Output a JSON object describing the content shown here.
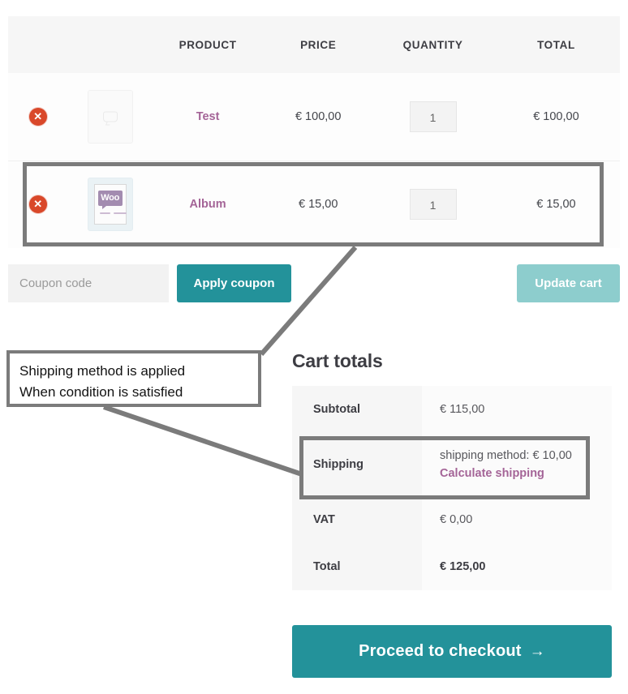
{
  "cart_table": {
    "headers": [
      "",
      "",
      "PRODUCT",
      "PRICE",
      "QUANTITY",
      "TOTAL"
    ],
    "remove_icon": "remove-x-icon",
    "rows": [
      {
        "remove_label": "✕",
        "thumbnail": "product-placeholder-image",
        "product": "Test",
        "price": "€ 100,00",
        "quantity": "1",
        "total": "€ 100,00"
      },
      {
        "remove_label": "✕",
        "thumbnail": "woo-album-image",
        "thumbnail_text": "Woo",
        "product": "Album",
        "price": "€ 15,00",
        "quantity": "1",
        "total": "€ 15,00"
      }
    ]
  },
  "coupon": {
    "placeholder": "Coupon code",
    "value": "",
    "apply_label": "Apply coupon",
    "update_label": "Update cart"
  },
  "totals": {
    "title": "Cart totals",
    "rows": [
      {
        "label": "Subtotal",
        "value": "€ 115,00"
      },
      {
        "label": "Shipping",
        "value": "shipping method: € 10,00",
        "link": "Calculate shipping"
      },
      {
        "label": "VAT",
        "value": "€ 0,00"
      },
      {
        "label": "Total",
        "value": "€ 125,00"
      }
    ],
    "checkout_label": "Proceed to checkout",
    "checkout_arrow": "→"
  },
  "annotation": {
    "line1": "Shipping method is applied",
    "line2": "When condition is satisfied"
  },
  "colors": {
    "accent_teal": "#23929a",
    "accent_teal_light": "#8dcdcd",
    "link_purple": "#a46497",
    "remove_red": "#d9482a",
    "annotation_gray": "#7b7b7b",
    "header_bg": "#f6f6f6"
  }
}
